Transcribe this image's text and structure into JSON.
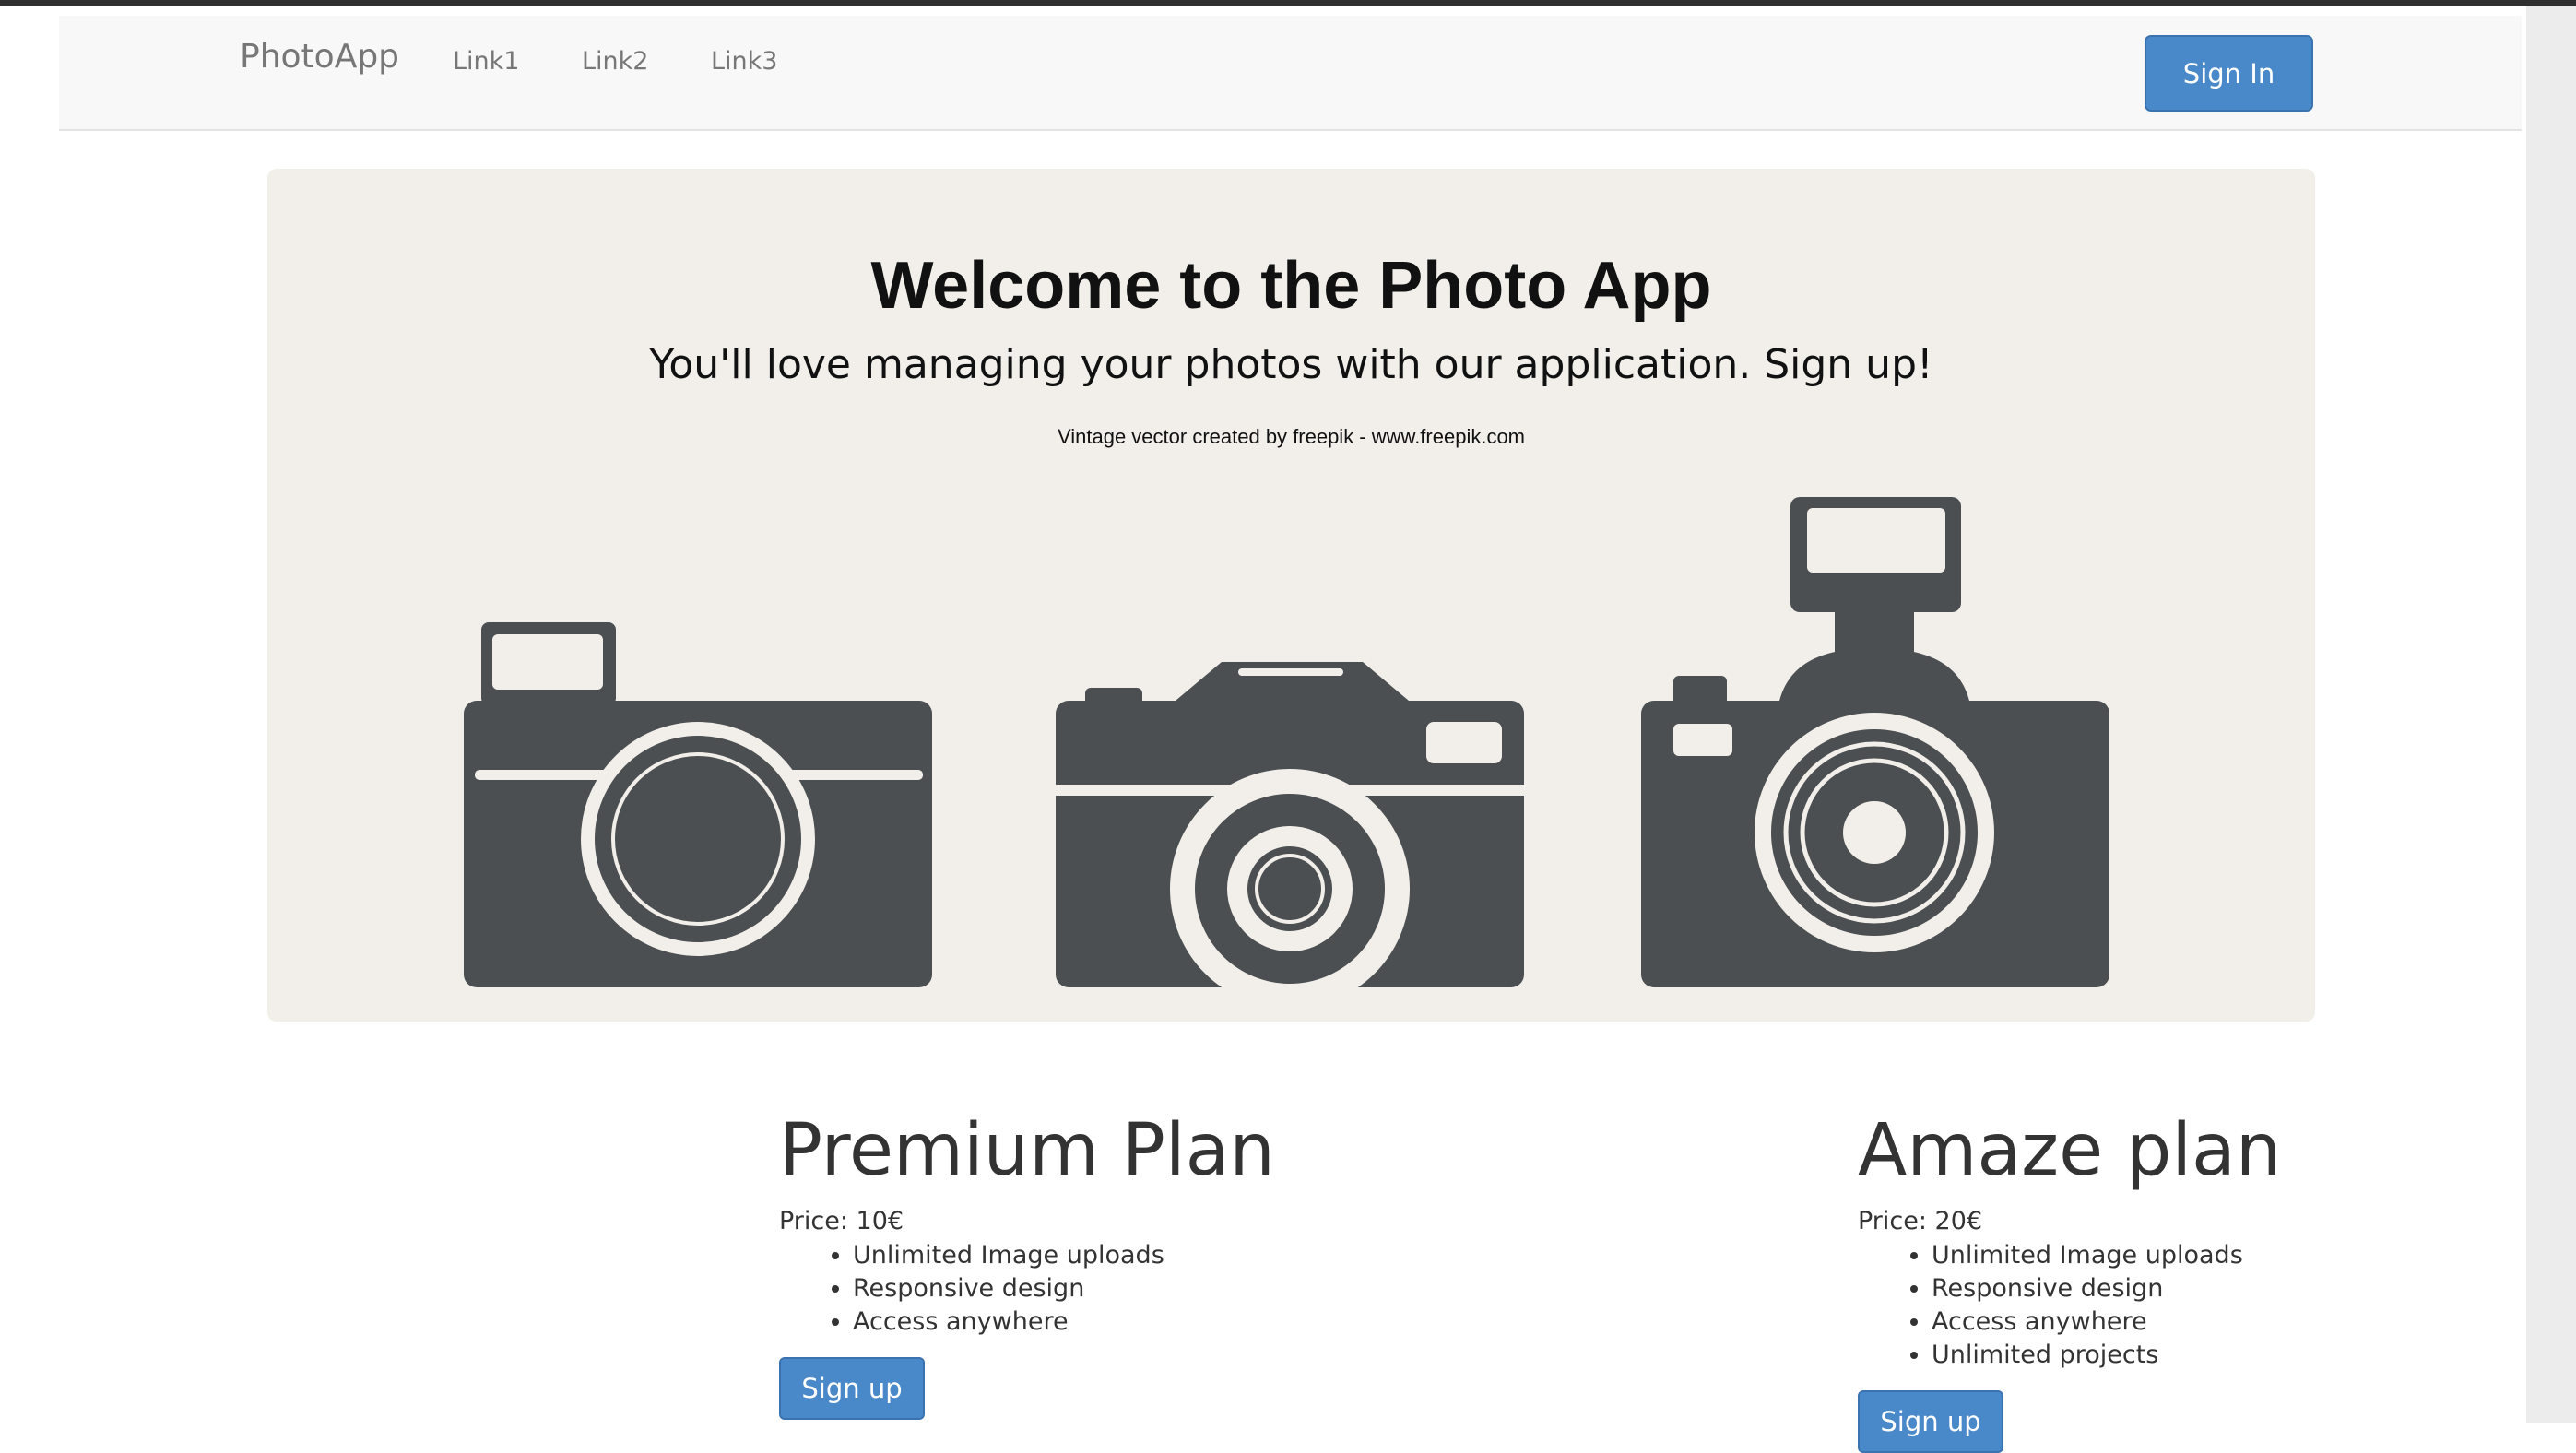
{
  "navbar": {
    "brand": "PhotoApp",
    "links": [
      "Link1",
      "Link2",
      "Link3"
    ],
    "signin_label": "Sign In"
  },
  "hero": {
    "title": "Welcome to the Photo App",
    "subtitle": "You'll love managing your photos with our application. Sign up!",
    "credit": "Vintage vector created by freepik - www.freepik.com"
  },
  "plans": [
    {
      "name": "Premium Plan",
      "price": "Price: 10€",
      "features": [
        "Unlimited Image uploads",
        "Responsive design",
        "Access anywhere"
      ],
      "button": "Sign up"
    },
    {
      "name": "Amaze plan",
      "price": "Price: 20€",
      "features": [
        "Unlimited Image uploads",
        "Responsive design",
        "Access anywhere",
        "Unlimited projects"
      ],
      "button": "Sign up"
    }
  ],
  "colors": {
    "primary": "#4a89c9",
    "camera": "#4b4f51",
    "hero_bg": "#f2efea",
    "nav_bg": "#f8f8f8"
  }
}
